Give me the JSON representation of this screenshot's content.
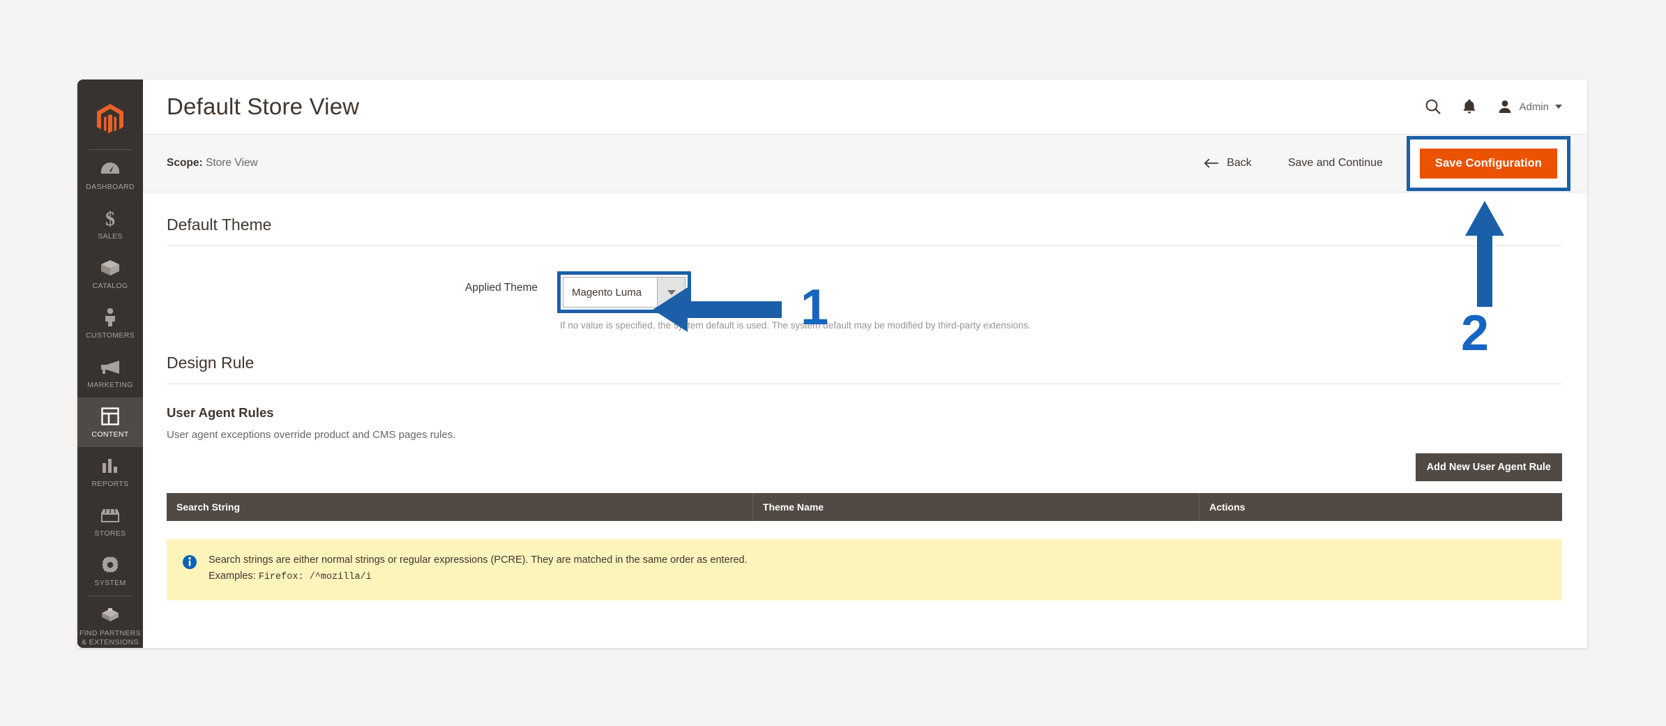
{
  "sidebar": {
    "logo": "magento-logo",
    "items": [
      {
        "label": "DASHBOARD",
        "icon": "dashboard-icon",
        "active": false
      },
      {
        "label": "SALES",
        "icon": "dollar-icon",
        "active": false
      },
      {
        "label": "CATALOG",
        "icon": "box-icon",
        "active": false
      },
      {
        "label": "CUSTOMERS",
        "icon": "person-icon",
        "active": false
      },
      {
        "label": "MARKETING",
        "icon": "megaphone-icon",
        "active": false
      },
      {
        "label": "CONTENT",
        "icon": "layout-icon",
        "active": true
      },
      {
        "label": "REPORTS",
        "icon": "bar-chart-icon",
        "active": false
      },
      {
        "label": "STORES",
        "icon": "storefront-icon",
        "active": false
      },
      {
        "label": "SYSTEM",
        "icon": "gear-icon",
        "active": false
      },
      {
        "label": "FIND PARTNERS & EXTENSIONS",
        "icon": "extension-icon",
        "active": false
      }
    ]
  },
  "header": {
    "title": "Default Store View",
    "search_icon": "search-icon",
    "notifications_icon": "bell-icon",
    "account_icon": "user-avatar-icon",
    "account_label": "Admin"
  },
  "scope_bar": {
    "scope_label": "Scope:",
    "scope_value": "Store View",
    "back_label": "Back",
    "back_icon": "arrow-left-icon",
    "save_and_continue_label": "Save and Continue",
    "save_configuration_label": "Save Configuration"
  },
  "default_theme": {
    "section_title": "Default Theme",
    "applied_theme_label": "Applied Theme",
    "applied_theme_value": "Magento Luma",
    "applied_theme_note": "If no value is specified, the system default is used. The system default may be modified by third-party extensions."
  },
  "design_rule": {
    "section_title": "Design Rule",
    "user_agent_rules_title": "User Agent Rules",
    "user_agent_rules_desc": "User agent exceptions override product and CMS pages rules.",
    "add_rule_label": "Add New User Agent Rule",
    "table": {
      "columns": [
        "Search String",
        "Theme Name",
        "Actions"
      ],
      "rows": []
    },
    "notice": {
      "icon": "info-icon",
      "line1": "Search strings are either normal strings or regular expressions (PCRE). They are matched in the same order as entered.",
      "line2_prefix": "Examples:",
      "line2_mono": "Firefox:  /^mozilla/i"
    }
  },
  "annotations": [
    {
      "number": "1",
      "icon": "arrow-left-annotation",
      "target": "applied-theme-select"
    },
    {
      "number": "2",
      "icon": "arrow-up-annotation",
      "target": "save-configuration-button"
    }
  ],
  "colors": {
    "accent_orange": "#eb5202",
    "sidebar_dark": "#373330",
    "annotation_blue": "#1665c1",
    "highlight_blue": "#1b5fa8",
    "notice_yellow": "#fdf4bc",
    "table_header": "#514943"
  }
}
